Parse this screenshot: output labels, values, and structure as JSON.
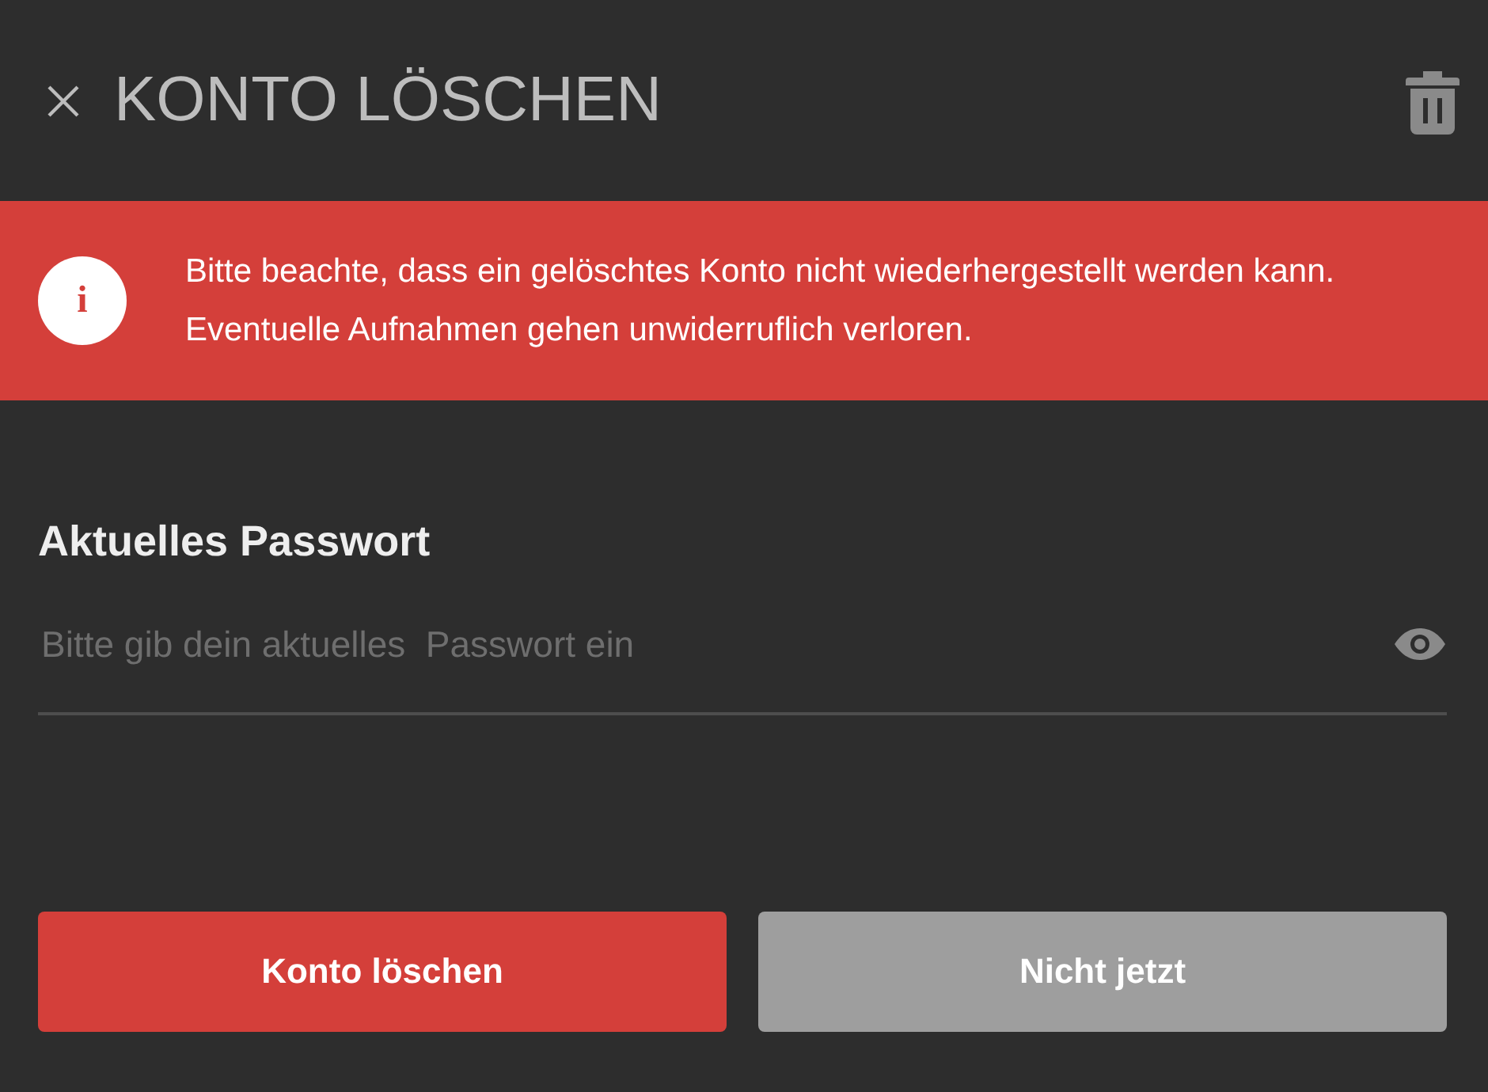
{
  "header": {
    "title": "KONTO LÖSCHEN"
  },
  "notice": {
    "text": "Bitte beachte, dass ein gelöschtes Konto nicht wiederhergestellt werden kann. Eventuelle Aufnahmen gehen unwiderruflich verloren.",
    "icon": "i"
  },
  "password": {
    "label": "Aktuelles Passwort",
    "placeholder": "Bitte gib dein aktuelles  Passwort ein"
  },
  "buttons": [
    {
      "label": "Konto löschen",
      "kind": "danger"
    },
    {
      "label": "Nicht jetzt",
      "kind": "secondary"
    }
  ]
}
